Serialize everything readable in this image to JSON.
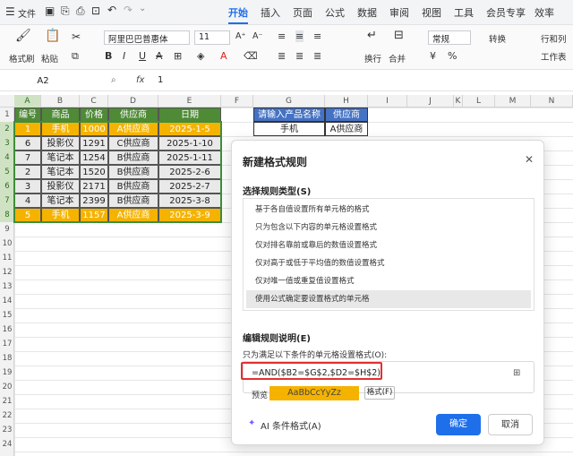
{
  "menu": {
    "file": "文件",
    "tabs": [
      "开始",
      "插入",
      "页面",
      "公式",
      "数据",
      "审阅",
      "视图",
      "工具",
      "会员专享",
      "效率"
    ],
    "active_tab": "开始"
  },
  "ribbon": {
    "format_painter": "格式刷",
    "paste": "粘贴",
    "font_name": "阿里巴巴普惠体",
    "font_size": "11",
    "wrap": "换行",
    "merge": "合并",
    "number_format": "常规",
    "convert": "转换",
    "row_col": "行和列",
    "worksheet": "工作表"
  },
  "formula_bar": {
    "name_box": "A2",
    "fx": "fx",
    "value": "1"
  },
  "columns": [
    "A",
    "B",
    "C",
    "D",
    "E",
    "F",
    "G",
    "H",
    "I",
    "J",
    "K",
    "L",
    "M",
    "N"
  ],
  "rows": [
    "1",
    "2",
    "3",
    "4",
    "5",
    "6",
    "7",
    "8",
    "9",
    "10",
    "11",
    "12",
    "13",
    "14",
    "15",
    "16",
    "17",
    "18",
    "19",
    "20",
    "21",
    "22",
    "23",
    "24"
  ],
  "table": {
    "headers": [
      "编号",
      "商品",
      "价格",
      "供应商",
      "日期"
    ],
    "rows": [
      [
        "1",
        "手机",
        "1000",
        "A供应商",
        "2025-1-5"
      ],
      [
        "6",
        "投影仪",
        "1291",
        "C供应商",
        "2025-1-10"
      ],
      [
        "7",
        "笔记本",
        "1254",
        "B供应商",
        "2025-1-11"
      ],
      [
        "2",
        "笔记本",
        "1520",
        "B供应商",
        "2025-2-6"
      ],
      [
        "3",
        "投影仪",
        "2171",
        "B供应商",
        "2025-2-7"
      ],
      [
        "4",
        "笔记本",
        "2399",
        "B供应商",
        "2025-3-8"
      ],
      [
        "5",
        "手机",
        "1157",
        "A供应商",
        "2025-3-9"
      ]
    ],
    "highlighted_rows": [
      0,
      6
    ]
  },
  "lookup": {
    "headers": [
      "请输入产品名称",
      "供应商"
    ],
    "values": [
      "手机",
      "A供应商"
    ]
  },
  "dialog": {
    "title": "新建格式规则",
    "select_type_label": "选择规则类型(S)",
    "rule_types": [
      "基于各自值设置所有单元格的格式",
      "只为包含以下内容的单元格设置格式",
      "仅对排名靠前或靠后的数值设置格式",
      "仅对高于或低于平均值的数值设置格式",
      "仅对唯一值或重复值设置格式",
      "使用公式确定要设置格式的单元格"
    ],
    "selected_rule_index": 5,
    "edit_desc_label": "编辑规则说明(E)",
    "formula_label": "只为满足以下条件的单元格设置格式(O):",
    "formula": "=AND($B2=$G$2,$D2=$H$2)",
    "preview_label": "预览",
    "preview_text": "AaBbCcYyZz",
    "format_button": "格式(F)",
    "ai_label": "AI 条件格式(A)",
    "ok": "确定",
    "cancel": "取消"
  },
  "colors": {
    "header_green": "#4f8a37",
    "highlight_orange": "#f5b300",
    "lookup_header_blue": "#4472c4",
    "accent_blue": "#1f6feb",
    "formula_box_red": "#e03030"
  }
}
